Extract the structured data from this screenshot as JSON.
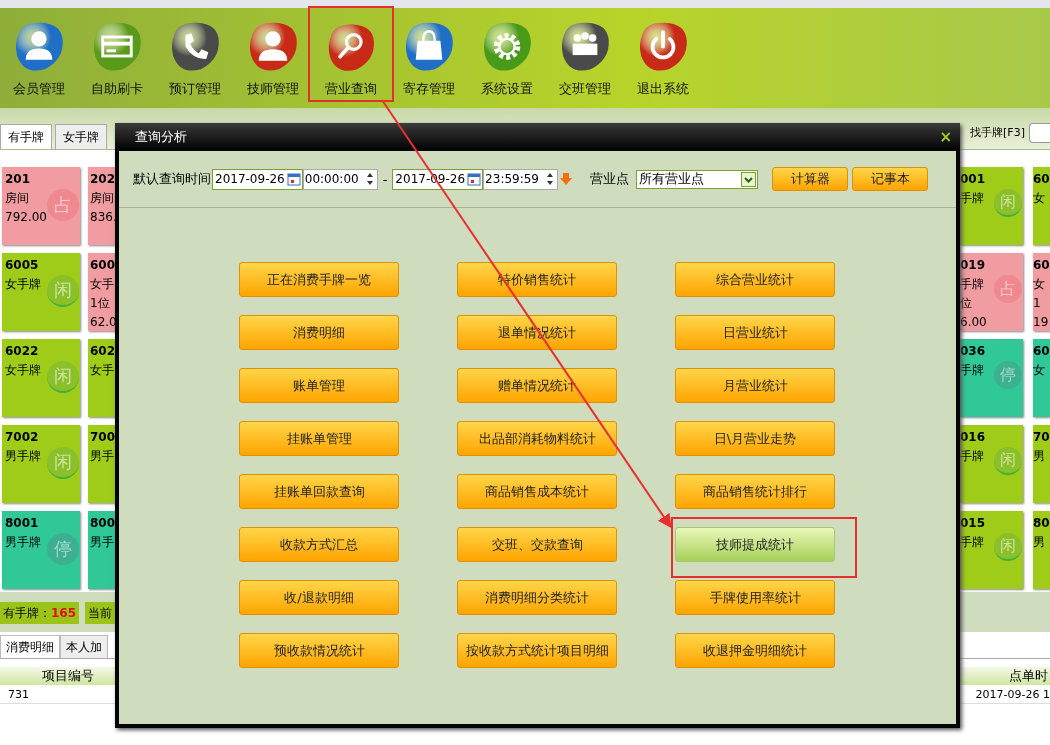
{
  "toolbar": [
    {
      "label": "会员管理",
      "kind": "person",
      "color": "#1f6fc8",
      "highlighted": false
    },
    {
      "label": "自助刷卡",
      "kind": "card",
      "color": "#5a9a1a",
      "highlighted": false
    },
    {
      "label": "预订管理",
      "kind": "phone",
      "color": "#4a4a4a",
      "highlighted": false
    },
    {
      "label": "技师管理",
      "kind": "worker",
      "color": "#c82a18",
      "highlighted": false
    },
    {
      "label": "营业查询",
      "kind": "search",
      "color": "#c82a18",
      "highlighted": true
    },
    {
      "label": "寄存管理",
      "kind": "bag",
      "color": "#1f6fc8",
      "highlighted": false
    },
    {
      "label": "系统设置",
      "kind": "gear",
      "color": "#4a9a1a",
      "highlighted": false
    },
    {
      "label": "交班管理",
      "kind": "meeting",
      "color": "#4a4a4a",
      "highlighted": false
    },
    {
      "label": "退出系统",
      "kind": "power",
      "color": "#c82a18",
      "highlighted": false
    }
  ],
  "card_tabs": [
    {
      "label": "有手牌",
      "selected": true
    },
    {
      "label": "女手牌",
      "selected": false
    }
  ],
  "search": {
    "label": "找手牌[F3]"
  },
  "card_columns": [
    {
      "cards": [
        {
          "lines": [
            "201",
            "房间",
            "792.00"
          ],
          "kind": "occupied",
          "mark": "占"
        },
        {
          "lines": [
            "6005",
            "女手牌"
          ],
          "kind": "idle",
          "mark": "闲"
        },
        {
          "lines": [
            "6022",
            "女手牌"
          ],
          "kind": "idle",
          "mark": "闲"
        },
        {
          "lines": [
            "7002",
            "男手牌"
          ],
          "kind": "idle",
          "mark": "闲"
        },
        {
          "lines": [
            "8001",
            "男手牌"
          ],
          "kind": "stopped",
          "mark": "停"
        }
      ]
    },
    {
      "cards": [
        {
          "lines": [
            "202",
            "房间",
            "836."
          ],
          "kind": "occupied"
        },
        {
          "lines": [
            "600",
            "女手",
            "1位",
            "62.0"
          ],
          "kind": "occupied"
        },
        {
          "lines": [
            "602",
            "女手"
          ],
          "kind": "idle"
        },
        {
          "lines": [
            "700",
            "男手"
          ],
          "kind": "idle"
        },
        {
          "lines": [
            "800",
            "男手"
          ],
          "kind": "stopped"
        }
      ]
    },
    {
      "cards": [
        {
          "lines": [
            "001",
            "手牌"
          ],
          "kind": "idle",
          "mark": "闲"
        },
        {
          "lines": [
            "019",
            "手牌",
            "位",
            "6.00"
          ],
          "kind": "occupied",
          "mark": "占"
        },
        {
          "lines": [
            "036",
            "手牌"
          ],
          "kind": "stopped",
          "mark": "停"
        },
        {
          "lines": [
            "016",
            "手牌"
          ],
          "kind": "idle",
          "mark": "闲"
        },
        {
          "lines": [
            "015",
            "手牌"
          ],
          "kind": "idle",
          "mark": "闲"
        }
      ]
    },
    {
      "cards": [
        {
          "lines": [
            "60",
            "女"
          ],
          "kind": "idle"
        },
        {
          "lines": [
            "60",
            "女",
            "1",
            "19"
          ],
          "kind": "occupied"
        },
        {
          "lines": [
            "60",
            "女"
          ],
          "kind": "stopped"
        },
        {
          "lines": [
            "70",
            "男"
          ],
          "kind": "idle"
        },
        {
          "lines": [
            "80",
            "男"
          ],
          "kind": "idle"
        }
      ]
    }
  ],
  "status_bar": {
    "label": "有手牌：",
    "count": "165",
    "current": "当前"
  },
  "bottom_tabs": [
    {
      "label": "消费明细",
      "selected": true
    },
    {
      "label": "本人加",
      "selected": false
    }
  ],
  "table": {
    "columns": [
      "项目编号",
      "点单时"
    ],
    "rows": [
      [
        "731",
        "2017-09-26 1"
      ]
    ]
  },
  "dialog": {
    "title": "查询分析",
    "close": "×",
    "query": {
      "label": "默认查询时间",
      "start_date": "2017-09-26",
      "start_time": "00:00:00",
      "separator": "-",
      "end_date": "2017-09-26",
      "end_time": "23:59:59",
      "outlet_label": "营业点",
      "outlet": "所有营业点",
      "buttons": [
        "计算器",
        "记事本"
      ]
    },
    "reports": [
      {
        "label": "正在消费手牌一览",
        "selected": false
      },
      {
        "label": "特价销售统计",
        "selected": false
      },
      {
        "label": "综合营业统计",
        "selected": false
      },
      {
        "label": "消费明细",
        "selected": false
      },
      {
        "label": "退单情况统计",
        "selected": false
      },
      {
        "label": "日营业统计",
        "selected": false
      },
      {
        "label": "账单管理",
        "selected": false
      },
      {
        "label": "赠单情况统计",
        "selected": false
      },
      {
        "label": "月营业统计",
        "selected": false
      },
      {
        "label": "挂账单管理",
        "selected": false
      },
      {
        "label": "出品部消耗物料统计",
        "selected": false
      },
      {
        "label": "日\\月营业走势",
        "selected": false
      },
      {
        "label": "挂账单回款查询",
        "selected": false
      },
      {
        "label": "商品销售成本统计",
        "selected": false
      },
      {
        "label": "商品销售统计排行",
        "selected": false
      },
      {
        "label": "收款方式汇总",
        "selected": false
      },
      {
        "label": "交班、交款查询",
        "selected": false
      },
      {
        "label": "技师提成统计",
        "selected": true
      },
      {
        "label": "收/退款明细",
        "selected": false
      },
      {
        "label": "消费明细分类统计",
        "selected": false
      },
      {
        "label": "手牌使用率统计",
        "selected": false
      },
      {
        "label": "预收款情况统计",
        "selected": false
      },
      {
        "label": "按收款方式统计项目明细",
        "selected": false
      },
      {
        "label": "收退押金明细统计",
        "selected": false
      }
    ]
  }
}
